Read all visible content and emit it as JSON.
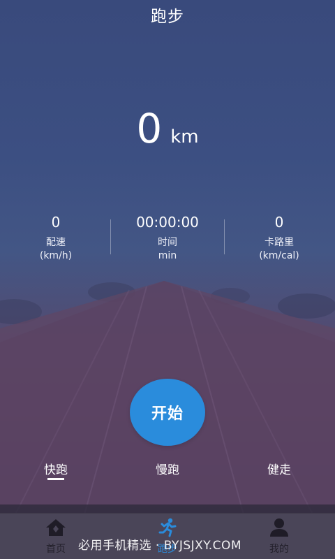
{
  "header": {
    "title": "跑步"
  },
  "distance": {
    "value": "0",
    "unit": "km"
  },
  "stats": [
    {
      "value": "0",
      "label": "配速",
      "unit": "(km/h)"
    },
    {
      "value": "00:00:00",
      "label": "时间",
      "unit": "min"
    },
    {
      "value": "0",
      "label": "卡路里",
      "unit": "(km/cal)"
    }
  ],
  "start_button": {
    "label": "开始"
  },
  "modes": [
    {
      "label": "快跑",
      "selected": true
    },
    {
      "label": "慢跑",
      "selected": false
    },
    {
      "label": "健走",
      "selected": false
    }
  ],
  "bottom_nav": [
    {
      "label": "首页",
      "icon": "home-icon",
      "active": false
    },
    {
      "label": "跑步",
      "icon": "runner-icon",
      "active": true
    },
    {
      "label": "我的",
      "icon": "user-icon",
      "active": false
    }
  ],
  "watermark": "必用手机精选 · BYJSJXY.COM",
  "colors": {
    "accent": "#2a8cdc",
    "nav_background": "#4a4558",
    "text": "#ffffff"
  }
}
